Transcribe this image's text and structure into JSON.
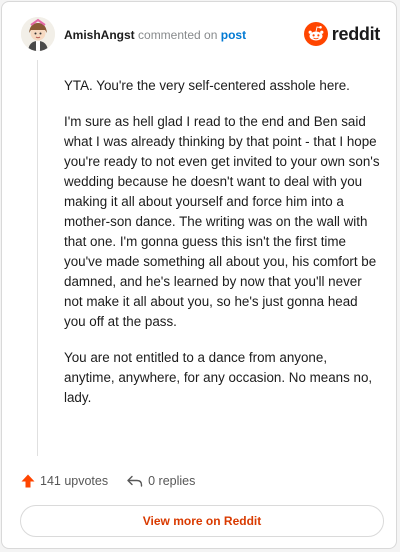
{
  "header": {
    "username": "AmishAngst",
    "action_text": "commented on",
    "post_link": "post",
    "brand": "reddit"
  },
  "comment": {
    "paragraphs": [
      "YTA. You're the very self-centered asshole here.",
      "I'm sure as hell glad I read to the end and Ben said what I was already thinking by that point - that I hope you're ready to not even get invited to your own son's wedding because he doesn't want to deal with you making it all about yourself and force him into a mother-son dance. The writing was on the wall with that one. I'm gonna guess this isn't the first time you've made something all about you, his comfort be damned, and he's learned by now that you'll never not make it all about you, so he's just gonna head you off at the pass.",
      "You are not entitled to a dance from anyone, anytime, anywhere, for any occasion. No means no, lady."
    ]
  },
  "actions": {
    "upvotes": "141 upvotes",
    "replies": "0 replies"
  },
  "footer": {
    "view_more": "View more on Reddit"
  },
  "colors": {
    "brand_orange": "#ff4500",
    "link_blue": "#0079d3",
    "button_text": "#d93a00"
  },
  "icons": [
    "avatar",
    "reddit-logo-icon",
    "upvote-arrow-icon",
    "reply-arrow-icon"
  ]
}
